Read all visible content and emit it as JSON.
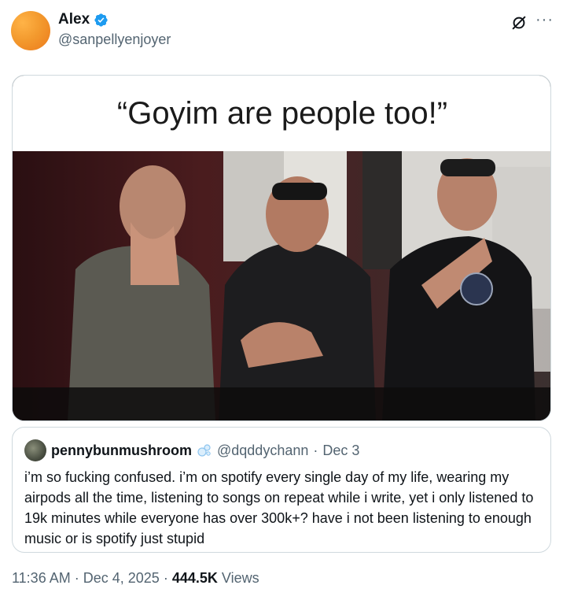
{
  "author": {
    "display_name": "Alex",
    "handle": "@sanpellyenjoyer",
    "avatar_color": "#f39a2e",
    "verified_color": "#1d9bf0"
  },
  "post": {
    "media_caption": "“Goyim are people too!”"
  },
  "quoted_post": {
    "display_name": "pennybunmushroom",
    "handle": "@dqddychann",
    "separator": "·",
    "date": "Dec 3",
    "text": "i’m so fucking confused. i’m on spotify every single day of my life, wearing my airpods all the time, listening to songs on repeat while i write, yet i only listened to 19k minutes while everyone has over 300k+? have i not been listening to enough music or is spotify just stupid"
  },
  "footer": {
    "time": "11:36 AM",
    "sep1": "·",
    "date": "Dec 4, 2025",
    "sep2": "·",
    "views_count": "444.5K",
    "views_label": "Views"
  },
  "icons": {
    "verified": "verified-badge-icon",
    "grok": "grok-icon",
    "more": "more-options-icon",
    "quoted_badge": "bubbles-badge-icon"
  }
}
